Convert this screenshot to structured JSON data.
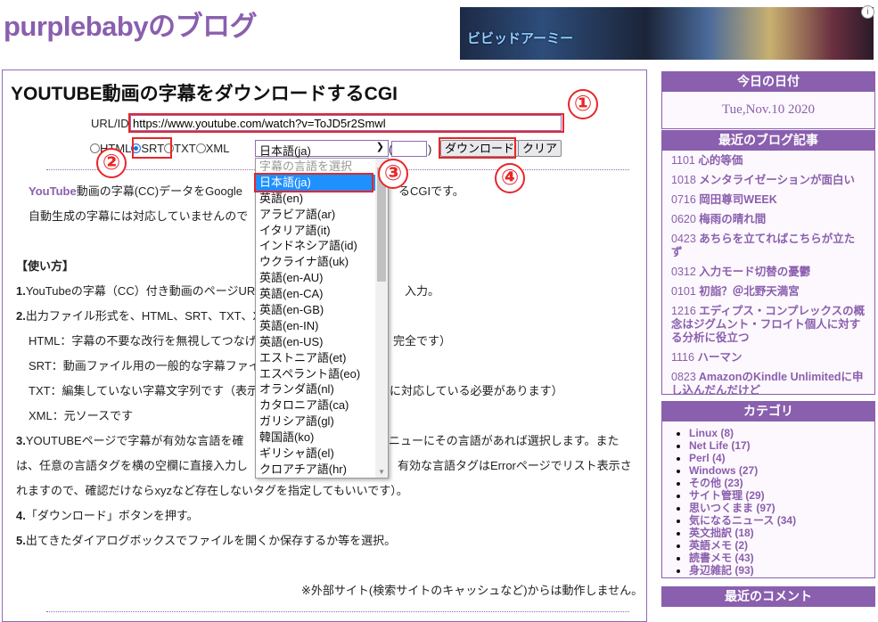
{
  "header": {
    "blog_title": "purplebabyのブログ",
    "banner_text": "ビビッドアーミー"
  },
  "main": {
    "title": "YOUTUBE動画の字幕をダウンロードするCGI",
    "url_label": "URL/ID",
    "url_value": "https://www.youtube.com/watch?v=ToJD5r2Smwl",
    "formats": [
      {
        "label": "HTML",
        "checked": false
      },
      {
        "label": "SRT",
        "checked": true
      },
      {
        "label": "TXT",
        "checked": false
      },
      {
        "label": "XML",
        "checked": false
      }
    ],
    "language_selected": "日本語(ja)",
    "paren_open": "(",
    "paren_close": ")",
    "download_label": "ダウンロード",
    "clear_label": "クリア",
    "intro_brand": "YouTube",
    "intro_line1": "動画の字幕(CC)データをGoogle",
    "intro_line1_end": "るCGIです。",
    "intro_line2": "自動生成の字幕には対応していませんので",
    "howto_title": "【使い方】",
    "step1_num": "1.",
    "step1": "YouTubeの字幕（CC）付き動画のページUR",
    "step1_end": "入力。",
    "step2_num": "2.",
    "step2": "出力ファイル形式を、HTML、SRT、TXT、XM",
    "html_desc": "HTML：字幕の不要な改行を無視してつなげ",
    "html_desc_end": "完全です）",
    "srt_desc": "SRT：動画ファイル用の一般的な字幕ファイ",
    "txt_desc": "TXT：編集していない字幕文字列です（表示",
    "txt_desc_end": "に対応している必要があります）",
    "xml_desc": "XML：元ソースです",
    "step3_num": "3.",
    "step3_a": "YOUTUBEページで字幕が有効な言語を確",
    "step3_a_end": "ニューにその言語があれば選択します。また",
    "step3_b": "は、任意の言語タグを横の空欄に直接入力し",
    "step3_b_end": "有効な言語タグはErrorページでリスト表示さ",
    "step3_c": "れますので、確認だけならxyzなど存在しないタグを指定してもいいです）。",
    "step4_num": "4.",
    "step4": "「ダウンロード」ボタンを押す。",
    "step5_num": "5.",
    "step5": "出てきたダイアログボックスでファイルを開くか保存するか等を選択。",
    "note": "※外部サイト(検索サイトのキャッシュなど)からは動作しません。"
  },
  "dropdown": {
    "placeholder": "字幕の言語を選択",
    "options": [
      "日本語(ja)",
      "英語(en)",
      "アラビア語(ar)",
      "イタリア語(it)",
      "インドネシア語(id)",
      "ウクライナ語(uk)",
      "英語(en-AU)",
      "英語(en-CA)",
      "英語(en-GB)",
      "英語(en-IN)",
      "英語(en-US)",
      "エストニア語(et)",
      "エスペラント語(eo)",
      "オランダ語(nl)",
      "カタロニア語(ca)",
      "ガリシア語(gl)",
      "韓国語(ko)",
      "ギリシャ語(el)",
      "クロアチア語(hr)"
    ],
    "selected_index": 0
  },
  "annotations": [
    "①",
    "②",
    "③",
    "④"
  ],
  "sidebar": {
    "date_title": "今日の日付",
    "date": "Tue,Nov.10 2020",
    "posts_title": "最近のブログ記事",
    "posts": [
      {
        "num": "1101",
        "title": "心的等価"
      },
      {
        "num": "1018",
        "title": "メンタライゼーションが面白い"
      },
      {
        "num": "0716",
        "title": "岡田尊司WEEK"
      },
      {
        "num": "0620",
        "title": "梅雨の晴れ間"
      },
      {
        "num": "0423",
        "title": "あちらを立てればこちらが立たず"
      },
      {
        "num": "0312",
        "title": "入力モード切替の憂鬱"
      },
      {
        "num": "0101",
        "title": "初詣？＠北野天満宮"
      },
      {
        "num": "1216",
        "title": "エディプス・コンプレックスの概念はジグムント・フロイト個人に対する分析に役立つ"
      },
      {
        "num": "1116",
        "title": "ハーマン"
      },
      {
        "num": "0823",
        "title": "AmazonのKindle Unlimitedに申し込んだんだけど"
      }
    ],
    "categories_title": "カテゴリ",
    "categories": [
      "Linux (8)",
      "Net Life (17)",
      "Perl (4)",
      "Windows (27)",
      "その他 (23)",
      "サイト管理 (29)",
      "思いつくまま (97)",
      "気になるニュース (34)",
      "英文拙訳 (18)",
      "英語メモ (2)",
      "読書メモ (43)",
      "身辺雑記 (93)"
    ],
    "comments_title": "最近のコメント"
  },
  "colors": {
    "accent": "#8a5fae",
    "annotation": "#e8262a",
    "selected": "#1e90ff"
  }
}
